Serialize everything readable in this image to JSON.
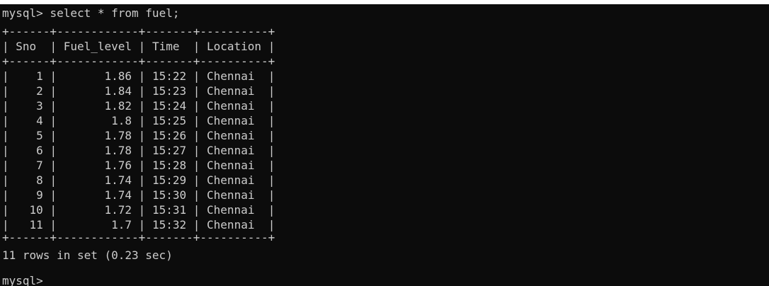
{
  "terminal": {
    "prompt": "mysql>",
    "command": "select * from fuel;",
    "table": {
      "border": "+------+------------+-------+----------+",
      "columns": [
        "Sno",
        "Fuel_level",
        "Time",
        "Location"
      ],
      "rows": [
        [
          "1",
          "1.86",
          "15:22",
          "Chennai"
        ],
        [
          "2",
          "1.84",
          "15:23",
          "Chennai"
        ],
        [
          "3",
          "1.82",
          "15:24",
          "Chennai"
        ],
        [
          "4",
          "1.8",
          "15:25",
          "Chennai"
        ],
        [
          "5",
          "1.78",
          "15:26",
          "Chennai"
        ],
        [
          "6",
          "1.78",
          "15:27",
          "Chennai"
        ],
        [
          "7",
          "1.76",
          "15:28",
          "Chennai"
        ],
        [
          "8",
          "1.74",
          "15:29",
          "Chennai"
        ],
        [
          "9",
          "1.74",
          "15:30",
          "Chennai"
        ],
        [
          "10",
          "1.72",
          "15:31",
          "Chennai"
        ],
        [
          "11",
          "1.7",
          "15:32",
          "Chennai"
        ]
      ]
    },
    "status": "11 rows in set (0.23 sec)",
    "final_prompt": "mysql>"
  },
  "colors": {
    "background": "#0c0c0c",
    "text": "#cccccc"
  }
}
